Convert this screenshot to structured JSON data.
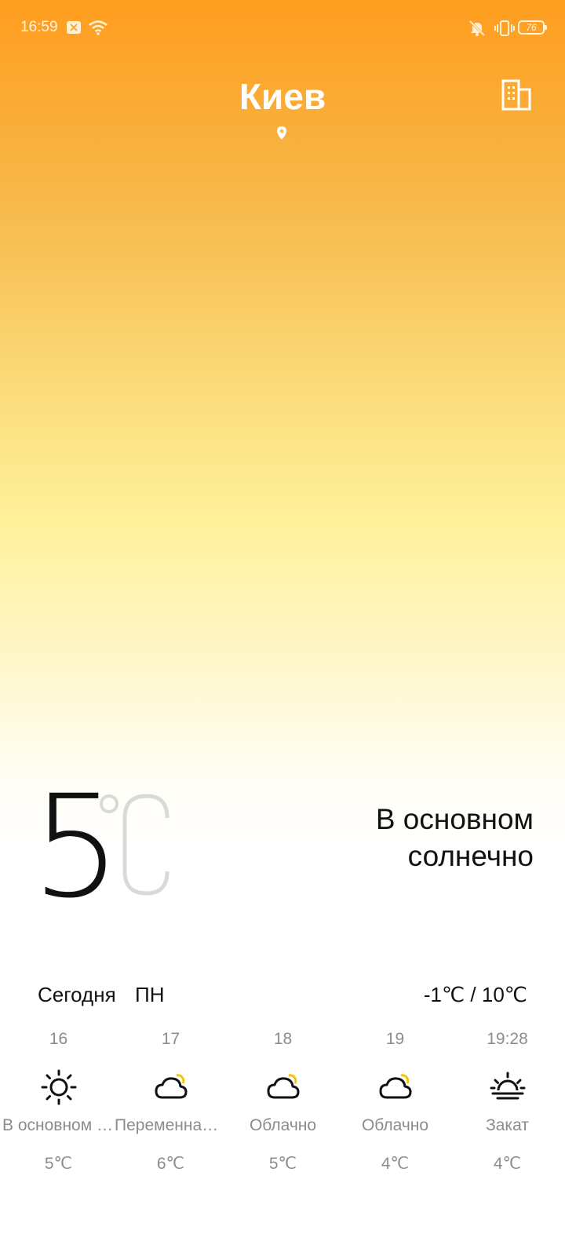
{
  "status_bar": {
    "time": "16:59",
    "battery": "76",
    "icons": [
      "notification-icon",
      "wifi-icon",
      "mute-icon",
      "vibrate-icon",
      "battery-icon"
    ]
  },
  "header": {
    "city": "Киев",
    "location_icon": "location-pin-icon",
    "city_list_icon": "buildings-icon"
  },
  "current": {
    "temperature": "5",
    "unit": "°C",
    "condition": "В основном солнечно"
  },
  "today": {
    "label": "Сегодня",
    "weekday": "ПН",
    "range": "-1℃ / 10℃"
  },
  "hourly": [
    {
      "time": "16",
      "icon": "sun-icon",
      "condition": "В основном солнечно",
      "temp": "5℃"
    },
    {
      "time": "17",
      "icon": "partly-cloudy-icon",
      "condition": "Переменная облачность",
      "temp": "6℃"
    },
    {
      "time": "18",
      "icon": "partly-cloudy-icon",
      "condition": "Облачно",
      "temp": "5℃"
    },
    {
      "time": "19",
      "icon": "partly-cloudy-icon",
      "condition": "Облачно",
      "temp": "4℃"
    },
    {
      "time": "19:28",
      "icon": "sunset-icon",
      "condition": "Закат",
      "temp": "4℃"
    }
  ],
  "colors": {
    "gradient_top": "#ff9d1f",
    "gradient_mid": "#fff19a",
    "gradient_bottom": "#ffffff",
    "sun_accent": "#f5c400"
  }
}
